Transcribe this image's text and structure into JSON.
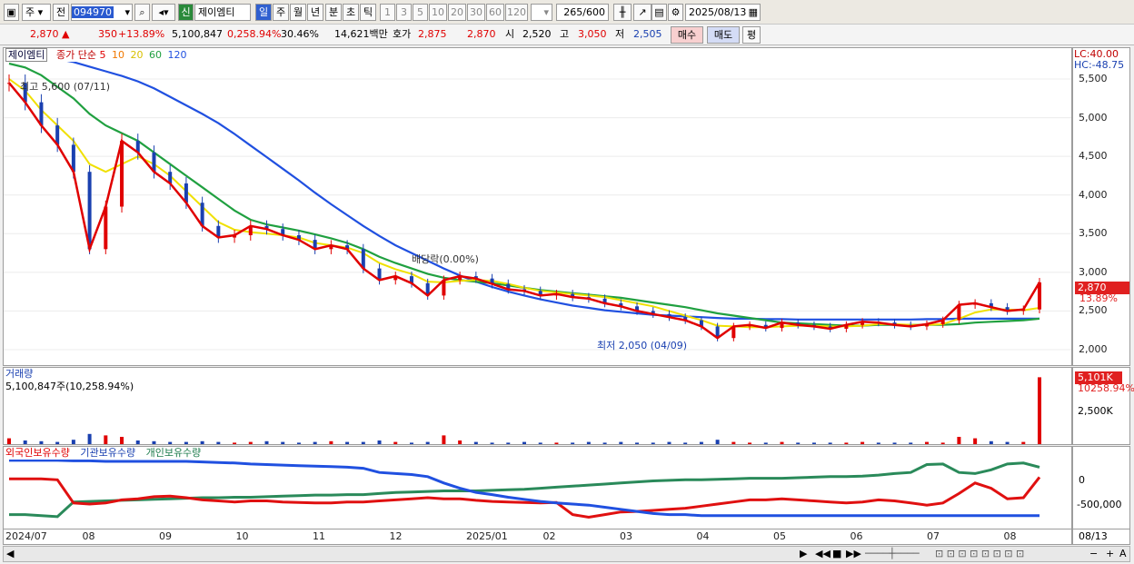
{
  "toolbar": {
    "mode1": "주",
    "mode2": "전",
    "code": "094970",
    "name": "제이엠티",
    "new_badge": "신",
    "periods": [
      "일",
      "주",
      "월",
      "년",
      "분",
      "초",
      "틱"
    ],
    "ticks": [
      "1",
      "3",
      "5",
      "10",
      "20",
      "30",
      "60",
      "120"
    ],
    "count": "265",
    "count_max": "/600",
    "date": "2025/08/13"
  },
  "quote": {
    "price": "2,870",
    "change": "350",
    "change_pct": "+13.89%",
    "volume": "5,100,847",
    "vol_ratio": "0,258.94%",
    "turnover": "30.46%",
    "amount": "14,621백만",
    "ask_label": "호가",
    "ask": "2,875",
    "bid": "2,870",
    "open_label": "시",
    "open": "2,520",
    "high_label": "고",
    "high": "3,050",
    "low_label": "저",
    "low": "2,505",
    "buy": "매수",
    "sell": "매도",
    "avg": "평"
  },
  "legend": {
    "name": "제이엠티",
    "series": "종가 단순",
    "ma5": "5",
    "ma10": "10",
    "ma20": "20",
    "ma60": "60",
    "ma120": "120"
  },
  "right_axis": {
    "lc": "LC:40.00",
    "hc": "HC:-48.75",
    "last": "2,870",
    "pct": "13.89%",
    "vol_last": "5,101K",
    "vol_pct": "10258.94%"
  },
  "volume_panel": {
    "title": "거래량",
    "summary": "5,100,847주(10,258.94%)"
  },
  "holdings_panel": {
    "foreign": "외국인보유수량",
    "institution": "기관보유수량",
    "individual": "개인보유수량"
  },
  "bottom_date": "08/13",
  "colors": {
    "up": "#e00000",
    "down": "#1a40b0",
    "ma5": "#e00000",
    "ma10": "#f07800",
    "ma20": "#f0e000",
    "ma60": "#20a040",
    "ma120": "#2050e0"
  },
  "chart_data": {
    "type": "candlestick",
    "price_axis": {
      "ticks": [
        "5,500",
        "5,000",
        "4,500",
        "4,000",
        "3,500",
        "3,000",
        "2,500",
        "2,000"
      ],
      "range": [
        1800,
        5900
      ]
    },
    "volume_axis": {
      "ticks": [
        "2,500K"
      ]
    },
    "holdings_axis": {
      "ticks": [
        "0",
        "-500,000"
      ]
    },
    "x_labels": [
      "2024/07",
      "08",
      "09",
      "10",
      "11",
      "12",
      "2025/01",
      "02",
      "03",
      "04",
      "05",
      "06",
      "07",
      "08"
    ],
    "annotations": {
      "high": "최고 5,600 (07/11)",
      "low": "최저 2,050 (04/09)",
      "dividend": "배당락(0.00%)"
    },
    "close": [
      5450,
      5200,
      4900,
      4650,
      4300,
      3300,
      3850,
      4700,
      4550,
      4300,
      4150,
      3900,
      3600,
      3450,
      3480,
      3600,
      3560,
      3480,
      3420,
      3300,
      3350,
      3300,
      3050,
      2900,
      2950,
      2860,
      2700,
      2900,
      2950,
      2920,
      2850,
      2780,
      2760,
      2700,
      2720,
      2680,
      2660,
      2600,
      2560,
      2500,
      2460,
      2420,
      2380,
      2300,
      2150,
      2300,
      2320,
      2280,
      2350,
      2320,
      2300,
      2270,
      2320,
      2360,
      2350,
      2320,
      2300,
      2330,
      2380,
      2580,
      2600,
      2550,
      2500,
      2520,
      2870
    ],
    "ma20": [
      5500,
      5350,
      5100,
      4900,
      4700,
      4400,
      4300,
      4400,
      4500,
      4400,
      4250,
      4050,
      3850,
      3650,
      3550,
      3520,
      3500,
      3480,
      3450,
      3380,
      3350,
      3320,
      3250,
      3120,
      3040,
      2980,
      2880,
      2870,
      2890,
      2900,
      2890,
      2850,
      2800,
      2760,
      2740,
      2720,
      2700,
      2680,
      2640,
      2600,
      2560,
      2500,
      2440,
      2380,
      2310,
      2300,
      2290,
      2290,
      2300,
      2310,
      2310,
      2300,
      2300,
      2310,
      2330,
      2330,
      2320,
      2320,
      2330,
      2400,
      2480,
      2520,
      2520,
      2510,
      2540
    ],
    "ma60": [
      5700,
      5650,
      5550,
      5400,
      5250,
      5050,
      4900,
      4800,
      4700,
      4550,
      4400,
      4250,
      4100,
      3950,
      3800,
      3680,
      3620,
      3580,
      3540,
      3490,
      3440,
      3380,
      3300,
      3200,
      3120,
      3050,
      2980,
      2930,
      2900,
      2880,
      2860,
      2830,
      2800,
      2770,
      2750,
      2730,
      2710,
      2690,
      2670,
      2640,
      2610,
      2580,
      2550,
      2510,
      2470,
      2440,
      2410,
      2380,
      2350,
      2340,
      2330,
      2320,
      2310,
      2310,
      2320,
      2320,
      2320,
      2320,
      2320,
      2330,
      2350,
      2360,
      2370,
      2380,
      2400
    ],
    "ma120": [
      5800,
      5800,
      5780,
      5760,
      5720,
      5660,
      5600,
      5540,
      5470,
      5380,
      5270,
      5160,
      5050,
      4930,
      4790,
      4640,
      4490,
      4340,
      4190,
      4030,
      3880,
      3740,
      3600,
      3470,
      3350,
      3250,
      3150,
      3050,
      2960,
      2880,
      2810,
      2750,
      2700,
      2650,
      2610,
      2570,
      2540,
      2510,
      2490,
      2470,
      2450,
      2440,
      2430,
      2420,
      2410,
      2400,
      2400,
      2395,
      2395,
      2390,
      2390,
      2390,
      2390,
      2390,
      2390,
      2390,
      2390,
      2395,
      2395,
      2400,
      2400,
      2400,
      2400,
      2400,
      2400
    ],
    "volume": [
      0.08,
      0.05,
      0.04,
      0.03,
      0.06,
      0.14,
      0.12,
      0.1,
      0.05,
      0.04,
      0.03,
      0.03,
      0.04,
      0.03,
      0.02,
      0.03,
      0.04,
      0.03,
      0.02,
      0.03,
      0.04,
      0.03,
      0.03,
      0.05,
      0.03,
      0.02,
      0.03,
      0.12,
      0.05,
      0.03,
      0.02,
      0.02,
      0.03,
      0.02,
      0.02,
      0.02,
      0.03,
      0.02,
      0.03,
      0.02,
      0.02,
      0.03,
      0.02,
      0.03,
      0.06,
      0.03,
      0.02,
      0.02,
      0.03,
      0.02,
      0.02,
      0.02,
      0.02,
      0.03,
      0.02,
      0.02,
      0.02,
      0.03,
      0.02,
      0.1,
      0.08,
      0.04,
      0.03,
      0.03,
      0.92
    ],
    "foreign": [
      330000,
      330000,
      330000,
      330000,
      320000,
      320000,
      310000,
      310000,
      310000,
      310000,
      310000,
      310000,
      300000,
      290000,
      280000,
      260000,
      250000,
      240000,
      230000,
      220000,
      210000,
      200000,
      180000,
      100000,
      80000,
      60000,
      20000,
      -100000,
      -200000,
      -280000,
      -320000,
      -370000,
      -410000,
      -450000,
      -480000,
      -500000,
      -520000,
      -560000,
      -600000,
      -640000,
      -680000,
      -700000,
      -700000,
      -720000,
      -720000,
      -720000,
      -720000,
      -720000,
      -720000,
      -720000,
      -720000,
      -720000,
      -720000,
      -720000,
      -720000,
      -720000,
      -720000,
      -720000,
      -720000,
      -720000,
      -720000,
      -720000,
      -720000,
      -720000,
      -720000
    ],
    "institution": [
      -20000,
      -20000,
      -20000,
      -40000,
      -480000,
      -500000,
      -480000,
      -420000,
      -400000,
      -360000,
      -350000,
      -380000,
      -420000,
      -440000,
      -460000,
      -440000,
      -440000,
      -460000,
      -470000,
      -480000,
      -480000,
      -460000,
      -460000,
      -440000,
      -420000,
      -400000,
      -380000,
      -400000,
      -400000,
      -430000,
      -450000,
      -460000,
      -470000,
      -480000,
      -470000,
      -700000,
      -750000,
      -700000,
      -650000,
      -640000,
      -620000,
      -600000,
      -580000,
      -540000,
      -500000,
      -460000,
      -420000,
      -420000,
      -400000,
      -420000,
      -440000,
      -460000,
      -480000,
      -460000,
      -420000,
      -440000,
      -480000,
      -520000,
      -480000,
      -300000,
      -100000,
      -200000,
      -400000,
      -380000,
      10000
    ],
    "individual": [
      -700000,
      -700000,
      -720000,
      -740000,
      -460000,
      -450000,
      -440000,
      -430000,
      -420000,
      -410000,
      -400000,
      -390000,
      -380000,
      -380000,
      -370000,
      -370000,
      -360000,
      -350000,
      -340000,
      -330000,
      -330000,
      -320000,
      -320000,
      -300000,
      -280000,
      -270000,
      -260000,
      -250000,
      -250000,
      -250000,
      -240000,
      -230000,
      -220000,
      -200000,
      -180000,
      -160000,
      -140000,
      -120000,
      -100000,
      -80000,
      -60000,
      -50000,
      -40000,
      -40000,
      -30000,
      -20000,
      -10000,
      -10000,
      -10000,
      0,
      10000,
      20000,
      20000,
      30000,
      50000,
      80000,
      100000,
      250000,
      260000,
      100000,
      80000,
      150000,
      260000,
      280000,
      200000
    ]
  }
}
